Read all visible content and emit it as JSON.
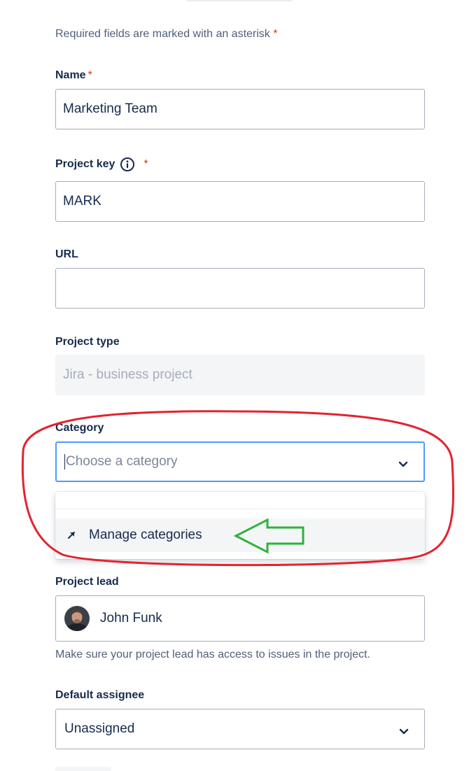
{
  "form": {
    "required_note": "Required fields are marked with an asterisk",
    "required_star": "*",
    "name": {
      "label": "Name",
      "value": "Marketing Team"
    },
    "project_key": {
      "label": "Project key",
      "value": "MARK"
    },
    "url": {
      "label": "URL",
      "value": ""
    },
    "project_type": {
      "label": "Project type",
      "value": "Jira - business project"
    },
    "category": {
      "label": "Category",
      "placeholder": "Choose a category"
    },
    "category_menu": {
      "manage_label": "Manage categories"
    },
    "project_lead": {
      "label": "Project lead",
      "value": "John Funk",
      "help": "Make sure your project lead has access to issues in the project."
    },
    "default_assignee": {
      "label": "Default assignee",
      "value": "Unassigned"
    }
  },
  "icons": {
    "info": "info-icon",
    "chevron": "chevron-down-icon",
    "external_link": "arrow-up-right-icon"
  },
  "colors": {
    "required": "#de350b",
    "focus": "#4c9aff",
    "annotation_ellipse": "#e3232f",
    "annotation_arrow": "#2db33a"
  }
}
